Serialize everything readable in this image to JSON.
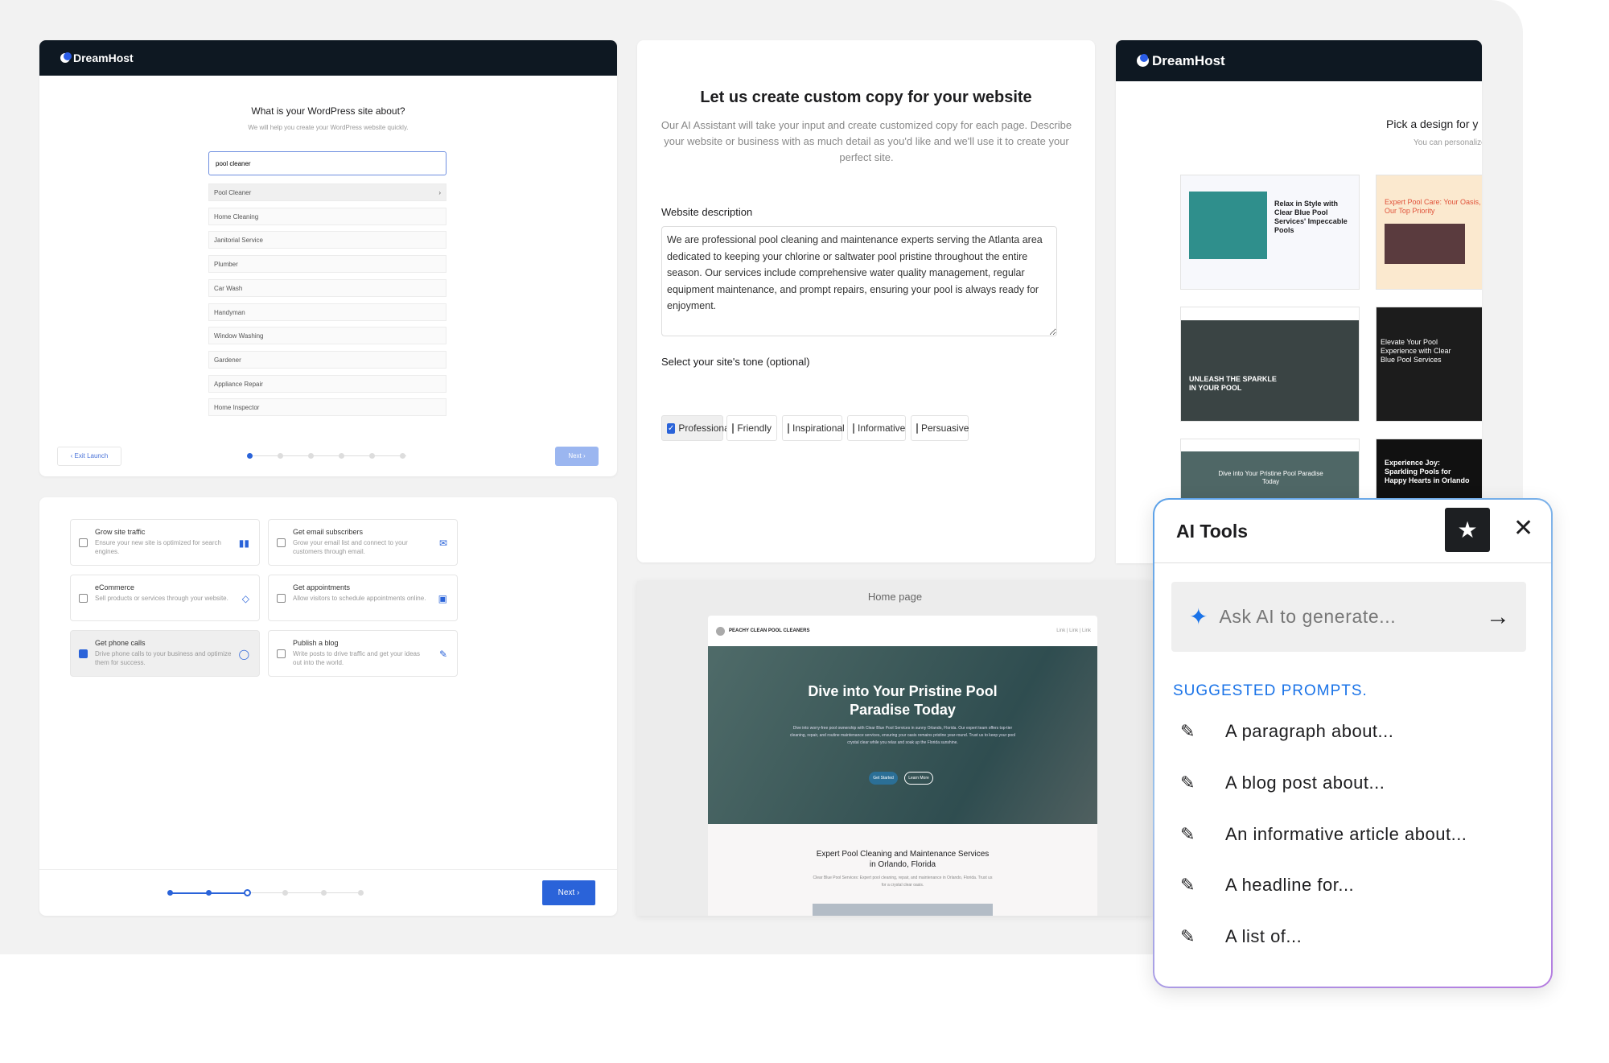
{
  "brand": {
    "name": "DreamHost"
  },
  "site_about": {
    "title": "What is your WordPress site about?",
    "subtitle": "We will help you create your WordPress website quickly.",
    "input_value": "pool cleaner",
    "suggestions": [
      "Pool Cleaner",
      "Home Cleaning",
      "Janitorial Service",
      "Plumber",
      "Car Wash",
      "Handyman",
      "Window Washing",
      "Gardener",
      "Appliance Repair",
      "Home Inspector"
    ],
    "exit_label": "‹ Exit Launch",
    "next_label": "Next ›",
    "progress_step": 1,
    "progress_total": 6
  },
  "goals": {
    "options": [
      {
        "title": "Grow site traffic",
        "desc": "Ensure your new site is optimized for search engines.",
        "icon": "bar-chart-icon",
        "glyph": "▮▮",
        "checked": false
      },
      {
        "title": "Get email subscribers",
        "desc": "Grow your email list and connect to your customers through email.",
        "icon": "envelope-icon",
        "glyph": "✉",
        "checked": false
      },
      {
        "title": "eCommerce",
        "desc": "Sell products or services through your website.",
        "icon": "tag-icon",
        "glyph": "◇",
        "checked": false
      },
      {
        "title": "Get appointments",
        "desc": "Allow visitors to schedule appointments online.",
        "icon": "calendar-icon",
        "glyph": "▣",
        "checked": false
      },
      {
        "title": "Get phone calls",
        "desc": "Drive phone calls to your business and optimize them for success.",
        "icon": "chat-bubble-icon",
        "glyph": "◯",
        "checked": true
      },
      {
        "title": "Publish a blog",
        "desc": "Write posts to drive traffic and get your ideas out into the world.",
        "icon": "pencil-icon",
        "glyph": "✎",
        "checked": false
      }
    ],
    "next_label": "Next ›",
    "progress_step": 3,
    "progress_total": 6
  },
  "copy": {
    "title": "Let us create custom copy for your website",
    "intro": "Our AI Assistant will take your input and create customized copy for each page. Describe your website or business with as much detail as you'd like and we'll use it to create your perfect site.",
    "desc_label": "Website description",
    "desc_value": "We are professional pool cleaning and maintenance experts serving the Atlanta area dedicated to keeping your chlorine or saltwater pool pristine throughout the entire season. Our services include comprehensive water quality management, regular equipment maintenance, and prompt repairs, ensuring your pool is always ready for enjoyment.",
    "tone_label": "Select your site's tone (optional)",
    "tones": [
      {
        "label": "Professional",
        "checked": true
      },
      {
        "label": "Friendly",
        "checked": false
      },
      {
        "label": "Inspirational",
        "checked": false
      },
      {
        "label": "Informative",
        "checked": false
      },
      {
        "label": "Persuasive",
        "checked": false
      }
    ]
  },
  "preview": {
    "label": "Home page",
    "site_name": "PEACHY CLEAN POOL CLEANERS",
    "nav": "Link | Link | Link",
    "hero_title": "Dive into Your Pristine Pool Paradise Today",
    "hero_text": "Dive into worry-free pool ownership with Clear Blue Pool Services in sunny Orlando, Florida. Our expert team offers top-tier cleaning, repair, and routine maintenance services, ensuring your oasis remains pristine year-round. Trust us to keep your pool crystal clear while you relax and soak up the Florida sunshine.",
    "cta_primary": "Get Started",
    "cta_secondary": "Learn More",
    "section_title": "Expert Pool Cleaning and Maintenance Services in Orlando, Florida",
    "section_text": "Clear Blue Pool Services: Expert pool cleaning, repair, and maintenance in Orlando, Florida. Trust us for a crystal clear oasis."
  },
  "design": {
    "title": "Pick a design for y",
    "subtitle": "You can personalize",
    "thumbs": [
      "Relax in Style with Clear Blue Pool Services' Impeccable Pools",
      "Expert Pool Care: Your Oasis, Our Top Priority",
      "UNLEASH THE SPARKLE IN YOUR POOL",
      "Elevate Your Pool Experience with Clear Blue Pool Services",
      "Dive into Your Pristine Pool Paradise Today",
      "Experience Joy: Sparkling Pools for Happy Hearts in Orlando"
    ]
  },
  "ai_tools": {
    "title": "AI Tools",
    "input_placeholder": "Ask AI to generate...",
    "section_label": "SUGGESTED PROMPTS.",
    "prompts": [
      "A paragraph about...",
      "A blog post about...",
      "An informative article about...",
      "A headline for...",
      "A list of..."
    ],
    "accent": "#1a73e8"
  }
}
